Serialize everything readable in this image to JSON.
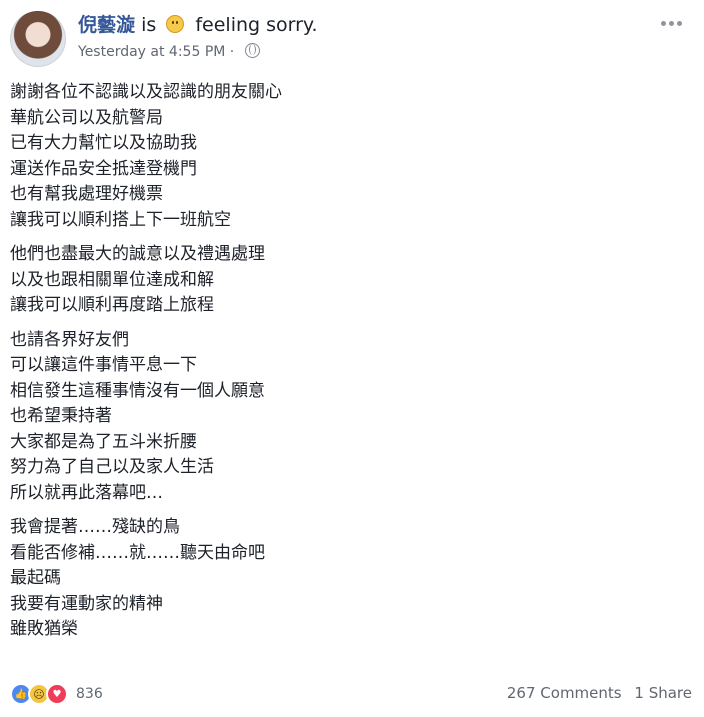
{
  "post": {
    "author": "倪藝漩",
    "is_text": "is",
    "feeling_text": "feeling sorry.",
    "timestamp": "Yesterday at 4:55 PM",
    "privacy_separator": "·",
    "body": [
      [
        "謝謝各位不認識以及認識的朋友關心",
        "華航公司以及航警局",
        "已有大力幫忙以及協助我",
        "運送作品安全抵達登機門",
        "也有幫我處理好機票",
        "讓我可以順利搭上下一班航空"
      ],
      [
        "他們也盡最大的誠意以及禮遇處理",
        "以及也跟相關單位達成和解",
        "讓我可以順利再度踏上旅程"
      ],
      [
        "也請各界好友們",
        "可以讓這件事情平息一下",
        "相信發生這種事情沒有一個人願意",
        "也希望秉持著",
        "大家都是為了五斗米折腰",
        "努力為了自己以及家人生活",
        "所以就再此落幕吧…"
      ],
      [
        "我會提著……殘缺的鳥",
        "看能否修補……就……聽天由命吧",
        "最起碼",
        "我要有運動家的精神",
        "雖敗猶榮"
      ]
    ]
  },
  "footer": {
    "reaction_count": "836",
    "comments": "267 Comments",
    "shares": "1 Share"
  },
  "icons": {
    "like": "like-icon",
    "sad": "sad-icon",
    "love": "love-icon",
    "globe": "globe-icon",
    "more": "more-icon"
  },
  "colors": {
    "author": "#365899",
    "meta": "#616770",
    "text": "#1d2129"
  }
}
